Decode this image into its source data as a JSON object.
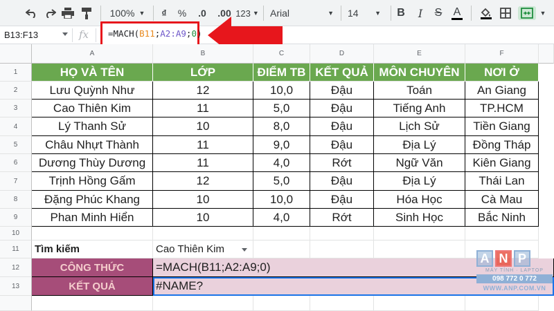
{
  "toolbar": {
    "zoom": "100%",
    "currency": "₫",
    "percent": "%",
    "dec_decrease": ".0",
    "dec_increase": ".00",
    "more_formats": "123",
    "font": "Arial",
    "font_size": "14",
    "bold": "B",
    "italic": "I",
    "strike": "S",
    "text_color": "A"
  },
  "formula_bar": {
    "name_box": "B13:F13",
    "fx": "fx",
    "formula_func": "=MACH(",
    "formula_ref1": "B11",
    "formula_sep1": ";",
    "formula_ref2": "A2:A9",
    "formula_sep2": ";",
    "formula_num": "0",
    "formula_close": ")"
  },
  "columns": [
    "A",
    "B",
    "C",
    "D",
    "E",
    "F"
  ],
  "rows": [
    "1",
    "2",
    "3",
    "4",
    "5",
    "6",
    "7",
    "8",
    "9",
    "10",
    "11",
    "12",
    "13"
  ],
  "table": {
    "headers": [
      "HỌ VÀ TÊN",
      "LỚP",
      "ĐIỂM TB",
      "KẾT QUẢ",
      "MÔN CHUYÊN",
      "NƠI Ở"
    ],
    "rows": [
      [
        "Lưu Quỳnh Như",
        "12",
        "10,0",
        "Đậu",
        "Toán",
        "An Giang"
      ],
      [
        "Cao Thiên Kim",
        "11",
        "5,0",
        "Đậu",
        "Tiếng Anh",
        "TP.HCM"
      ],
      [
        "Lý Thanh Sử",
        "10",
        "8,0",
        "Đậu",
        "Lịch Sử",
        "Tiền Giang"
      ],
      [
        "Châu Nhựt Thành",
        "11",
        "9,0",
        "Đậu",
        "Địa Lý",
        "Đồng Tháp"
      ],
      [
        "Dương Thùy Dương",
        "11",
        "4,0",
        "Rớt",
        "Ngữ Văn",
        "Kiên Giang"
      ],
      [
        "Trịnh Hồng Gấm",
        "12",
        "5,0",
        "Đậu",
        "Địa Lý",
        "Thái Lan"
      ],
      [
        "Đặng Phúc Khang",
        "10",
        "10,0",
        "Đậu",
        "Hóa Học",
        "Cà Mau"
      ],
      [
        "Phan Minh Hiển",
        "10",
        "4,0",
        "Rớt",
        "Sinh Học",
        "Bắc Ninh"
      ]
    ]
  },
  "search": {
    "label": "Tìm kiếm",
    "value": "Cao Thiên Kim"
  },
  "formula_row": {
    "label": "CÔNG THỨC",
    "value": "=MACH(B11;A2:A9;0)"
  },
  "result_row": {
    "label": "KẾT QUẢ",
    "value": "#NAME?"
  },
  "logo": {
    "letters": [
      "A",
      "N",
      "P"
    ],
    "tagline": "MÁY TÍNH · LAPTOP",
    "phone": "098 772 0 772",
    "website": "WWW.ANP.COM.VN"
  },
  "colors": {
    "header_green": "#6aa84f",
    "label_purple": "#a64d79",
    "pink_fill": "#ead1dc",
    "highlight_red": "#e7161c",
    "selection_blue": "#1a73e8"
  }
}
